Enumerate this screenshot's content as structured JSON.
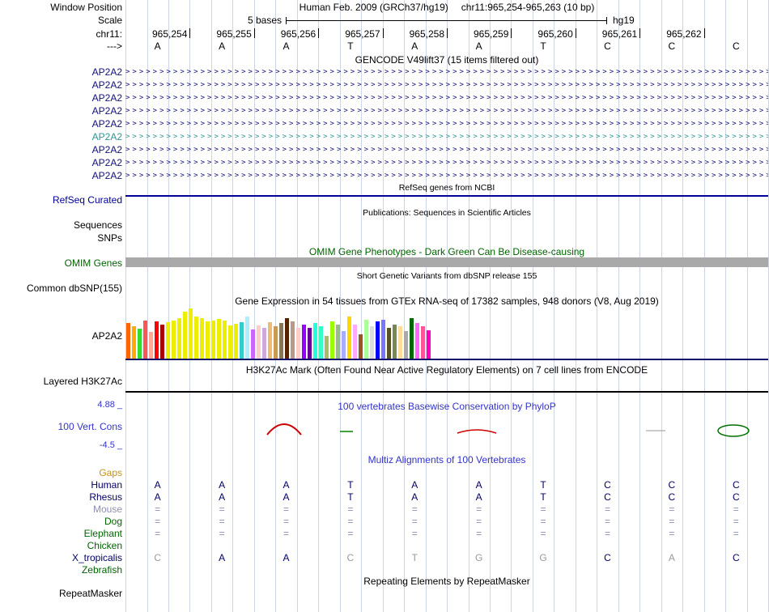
{
  "window": {
    "assembly_title": "Human Feb. 2009 (GRCh37/hg19)",
    "position_title": "chr11:965,254-965,263 (10 bp)",
    "window_position_label": "Window Position"
  },
  "ruler": {
    "scale_label": "Scale",
    "scale_value": "5 bases",
    "assembly_tag": "hg19",
    "chrom_label": "chr11:",
    "strand_label": "--->",
    "position_labels": [
      "965,254",
      "965,255",
      "965,256",
      "965,257",
      "965,258",
      "965,259",
      "965,260",
      "965,261",
      "965,262"
    ],
    "bases": [
      "A",
      "A",
      "A",
      "T",
      "A",
      "A",
      "T",
      "C",
      "C",
      "C"
    ]
  },
  "gencode": {
    "title": "GENCODE V49lift37 (15 items filtered out)",
    "glyph": ">",
    "transcripts": [
      {
        "label": "AP2A2",
        "color": "#10107E"
      },
      {
        "label": "AP2A2",
        "color": "#10107E"
      },
      {
        "label": "AP2A2",
        "color": "#10107E"
      },
      {
        "label": "AP2A2",
        "color": "#10107E"
      },
      {
        "label": "AP2A2",
        "color": "#10107E"
      },
      {
        "label": "AP2A2",
        "color": "#2F9595"
      },
      {
        "label": "AP2A2",
        "color": "#10107E"
      },
      {
        "label": "AP2A2",
        "color": "#10107E"
      },
      {
        "label": "AP2A2",
        "color": "#10107E"
      }
    ]
  },
  "refseq": {
    "title": "RefSeq genes from NCBI",
    "label": "RefSeq Curated",
    "color": "#000096"
  },
  "publications": {
    "title": "Publications: Sequences in Scientific Articles",
    "rows": [
      "Sequences",
      "SNPs"
    ]
  },
  "omim": {
    "title": "OMIM Gene Phenotypes - Dark Green Can Be Disease-causing",
    "label": "OMIM Genes",
    "color": "#006400",
    "bar_color": "#A9A9A9"
  },
  "dbsnp": {
    "title": "Short Genetic Variants from dbSNP release 155",
    "label": "Common dbSNP(155)"
  },
  "gtex": {
    "title": "Gene Expression in 54 tissues from GTEx RNA-seq of 17382 samples, 948 donors (V8, Aug 2019)",
    "label": "AP2A2",
    "baseline_color": "#13136B",
    "bars": [
      {
        "c": "#FF6600",
        "h": 44
      },
      {
        "c": "#FFAA00",
        "h": 40
      },
      {
        "c": "#33DD33",
        "h": 37
      },
      {
        "c": "#FF5555",
        "h": 47
      },
      {
        "c": "#FFAA99",
        "h": 33
      },
      {
        "c": "#FF0000",
        "h": 46
      },
      {
        "c": "#AA0000",
        "h": 42
      },
      {
        "c": "#EEEE00",
        "h": 45
      },
      {
        "c": "#EEEE00",
        "h": 47
      },
      {
        "c": "#EEEE00",
        "h": 50
      },
      {
        "c": "#EEEE00",
        "h": 58
      },
      {
        "c": "#EEEE00",
        "h": 62
      },
      {
        "c": "#EEEE00",
        "h": 52
      },
      {
        "c": "#EEEE00",
        "h": 50
      },
      {
        "c": "#EEEE00",
        "h": 46
      },
      {
        "c": "#EEEE00",
        "h": 47
      },
      {
        "c": "#EEEE00",
        "h": 49
      },
      {
        "c": "#EEEE00",
        "h": 47
      },
      {
        "c": "#EEEE00",
        "h": 41
      },
      {
        "c": "#EEEE00",
        "h": 43
      },
      {
        "c": "#33CCCC",
        "h": 45
      },
      {
        "c": "#AAEEFF",
        "h": 52
      },
      {
        "c": "#CC66FF",
        "h": 36
      },
      {
        "c": "#FFCCCC",
        "h": 41
      },
      {
        "c": "#CCAADD",
        "h": 38
      },
      {
        "c": "#EEBB77",
        "h": 45
      },
      {
        "c": "#CC9955",
        "h": 40
      },
      {
        "c": "#8B7355",
        "h": 44
      },
      {
        "c": "#552200",
        "h": 50
      },
      {
        "c": "#BB9988",
        "h": 46
      },
      {
        "c": "#FFCCCC",
        "h": 38
      },
      {
        "c": "#9900FF",
        "h": 42
      },
      {
        "c": "#660099",
        "h": 38
      },
      {
        "c": "#22FFDD",
        "h": 44
      },
      {
        "c": "#33FFC2",
        "h": 40
      },
      {
        "c": "#AABB66",
        "h": 28
      },
      {
        "c": "#99FF00",
        "h": 46
      },
      {
        "c": "#99BB88",
        "h": 42
      },
      {
        "c": "#AAAAFF",
        "h": 34
      },
      {
        "c": "#FFD700",
        "h": 52
      },
      {
        "c": "#FFAAFF",
        "h": 42
      },
      {
        "c": "#995522",
        "h": 30
      },
      {
        "c": "#AAFF99",
        "h": 48
      },
      {
        "c": "#DDDDDD",
        "h": 40
      },
      {
        "c": "#0000FF",
        "h": 46
      },
      {
        "c": "#7777FF",
        "h": 48
      },
      {
        "c": "#555522",
        "h": 38
      },
      {
        "c": "#778855",
        "h": 42
      },
      {
        "c": "#FFDD99",
        "h": 40
      },
      {
        "c": "#AAAAAA",
        "h": 34
      },
      {
        "c": "#006600",
        "h": 50
      },
      {
        "c": "#FF66FF",
        "h": 44
      },
      {
        "c": "#FF5599",
        "h": 40
      },
      {
        "c": "#FF00BB",
        "h": 35
      }
    ]
  },
  "h3k27ac": {
    "title": "H3K27Ac Mark (Often Found Near Active Regulatory Elements) on 7 cell lines from ENCODE",
    "label": "Layered H3K27Ac"
  },
  "conservation": {
    "title": "100 vertebrates Basewise Conservation by PhyloP",
    "label": "100 Vert. Cons",
    "max": "4.88 _",
    "min": "-4.5 _",
    "color": "#3333CC",
    "marks": [
      {
        "shape": "peak",
        "color": "#CC0000",
        "at": "965,256"
      },
      {
        "shape": "dash",
        "color": "#008200",
        "at": "965,257"
      },
      {
        "shape": "dip",
        "color": "#CC0000",
        "at": "965,258-965,259"
      },
      {
        "shape": "dash",
        "color": "#AAAAAA",
        "at": "965,261"
      },
      {
        "shape": "oval",
        "color": "#007000",
        "at": "965,262"
      }
    ]
  },
  "multiz": {
    "title": "Multiz Alignments of 100 Vertebrates",
    "color": "#3333CC",
    "rows": [
      {
        "name": "Gaps",
        "name_color": "#C79118",
        "cells": [
          "",
          "",
          "",
          "",
          "",
          "",
          "",
          "",
          "",
          ""
        ]
      },
      {
        "name": "Human",
        "name_color": "#000064",
        "cells": [
          "A",
          "A",
          "A",
          "T",
          "A",
          "A",
          "T",
          "C",
          "C",
          "C"
        ]
      },
      {
        "name": "Rhesus",
        "name_color": "#000064",
        "cells": [
          "A",
          "A",
          "A",
          "T",
          "A",
          "A",
          "T",
          "C",
          "C",
          "C"
        ]
      },
      {
        "name": "Mouse",
        "name_color": "#8E8EB4",
        "cells": [
          "=",
          "=",
          "=",
          "=",
          "=",
          "=",
          "=",
          "=",
          "=",
          "="
        ]
      },
      {
        "name": "Dog",
        "name_color": "#006400",
        "cell_colors": [
          "#8E8EB4",
          "#8E8EB4",
          "#8E8EB4",
          "#8E8EB4",
          "#8E8EB4",
          "#8E8EB4",
          "#8E8EB4",
          "#8E8EB4",
          "#8E8EB4",
          "#8E8EB4"
        ],
        "cells": [
          "=",
          "=",
          "=",
          "=",
          "=",
          "=",
          "=",
          "=",
          "=",
          "="
        ]
      },
      {
        "name": "Elephant",
        "name_color": "#006400",
        "cell_colors": [
          "#8E8EB4",
          "#8E8EB4",
          "#8E8EB4",
          "#8E8EB4",
          "#8E8EB4",
          "#8E8EB4",
          "#8E8EB4",
          "#8E8EB4",
          "#8E8EB4",
          "#8E8EB4"
        ],
        "cells": [
          "=",
          "=",
          "=",
          "=",
          "=",
          "=",
          "=",
          "=",
          "=",
          "="
        ]
      },
      {
        "name": "Chicken",
        "name_color": "#006400",
        "cells": [
          "",
          "",
          "",
          "",
          "",
          "",
          "",
          "",
          "",
          ""
        ]
      },
      {
        "name": "X_tropicalis",
        "name_color": "#000064",
        "cell_colors": [
          "#9A9A9A",
          "#000064",
          "#000064",
          "#9A9A9A",
          "#9A9A9A",
          "#9A9A9A",
          "#9A9A9A",
          "#000064",
          "#9A9A9A",
          "#000064"
        ],
        "cells": [
          "C",
          "A",
          "A",
          "C",
          "T",
          "G",
          "G",
          "C",
          "A",
          "C"
        ]
      },
      {
        "name": "Zebrafish",
        "name_color": "#006400",
        "cells": [
          "",
          "",
          "",
          "",
          "",
          "",
          "",
          "",
          "",
          ""
        ]
      }
    ]
  },
  "repeatmasker": {
    "title": "Repeating Elements by RepeatMasker",
    "label": "RepeatMasker"
  }
}
